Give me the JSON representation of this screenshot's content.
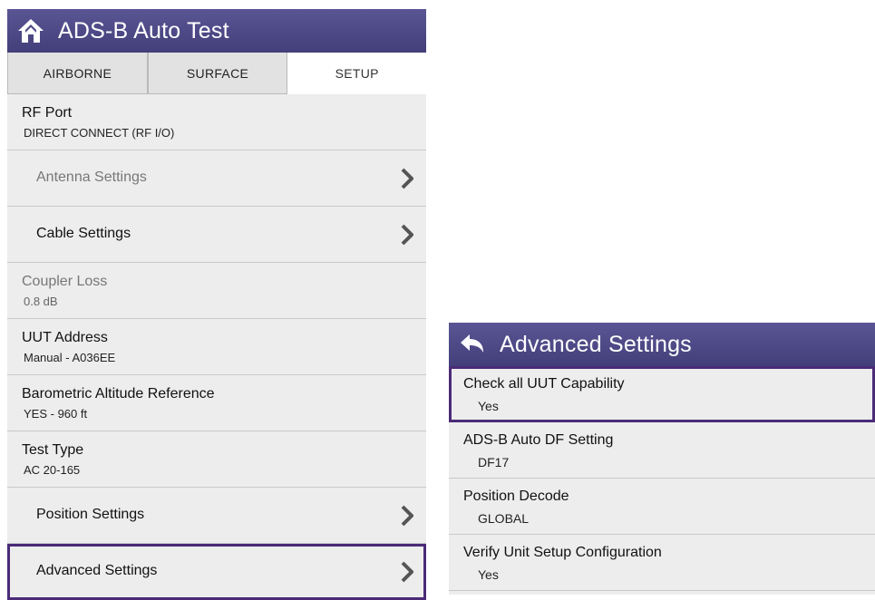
{
  "left": {
    "title": "ADS-B Auto Test",
    "tabs": [
      "AIRBORNE",
      "SURFACE",
      "SETUP"
    ],
    "active_tab": "SETUP",
    "rows": [
      {
        "label": "RF Port",
        "value": "DIRECT CONNECT (RF I/O)"
      },
      {
        "label": "Antenna Settings"
      },
      {
        "label": "Cable Settings"
      },
      {
        "label": "Coupler Loss",
        "value": "0.8 dB"
      },
      {
        "label": "UUT Address",
        "value": "Manual - A036EE"
      },
      {
        "label": "Barometric Altitude Reference",
        "value": "YES - 960 ft"
      },
      {
        "label": "Test Type",
        "value": "AC 20-165"
      },
      {
        "label": "Position Settings"
      },
      {
        "label": "Advanced Settings"
      }
    ]
  },
  "right": {
    "title": "Advanced Settings",
    "rows": [
      {
        "label": "Check all UUT Capability",
        "value": "Yes"
      },
      {
        "label": "ADS-B Auto DF Setting",
        "value": "DF17"
      },
      {
        "label": "Position Decode",
        "value": "GLOBAL"
      },
      {
        "label": "Verify Unit Setup Configuration",
        "value": "Yes"
      }
    ]
  },
  "icons": {
    "home": "home-icon",
    "back": "back-arrow-icon",
    "chevron": "chevron-right-icon"
  },
  "colors": {
    "titlebar": "#4e4a87",
    "selected_outline": "#4b2b78",
    "row_bg": "#ededed"
  }
}
